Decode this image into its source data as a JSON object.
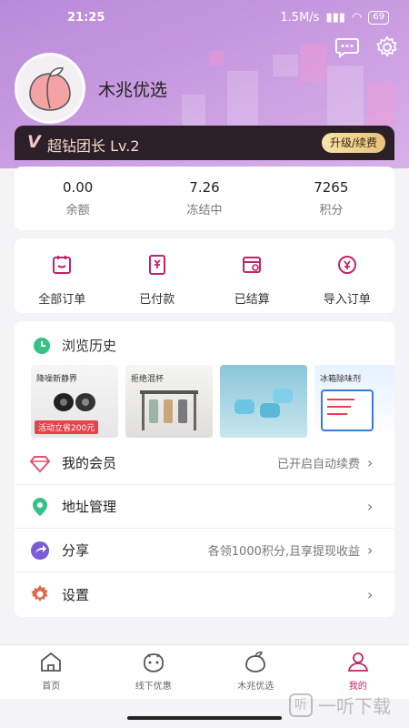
{
  "status_bar": {
    "time": "21:25",
    "network_speed": "1.5M/s",
    "battery": "69"
  },
  "profile": {
    "name": "木兆优选"
  },
  "vip": {
    "mark": "V",
    "title": "超钻团长 Lv.2",
    "upgrade_label": "升级/续费"
  },
  "stats": [
    {
      "value": "0.00",
      "label": "余额"
    },
    {
      "value": "7.26",
      "label": "冻结中"
    },
    {
      "value": "7265",
      "label": "积分"
    }
  ],
  "orders": [
    {
      "label": "全部订单",
      "icon": "calendar-icon"
    },
    {
      "label": "已付款",
      "icon": "paid-receipt-icon"
    },
    {
      "label": "已结算",
      "icon": "settled-box-icon"
    },
    {
      "label": "导入订单",
      "icon": "import-yen-icon"
    }
  ],
  "history": {
    "title": "浏览历史",
    "thumbs": [
      {
        "text": "降噪新静界",
        "tag": "活动立省200元"
      },
      {
        "text": "拒绝混杯",
        "tag": ""
      },
      {
        "text": "",
        "tag": ""
      },
      {
        "text": "冰箱除味剂",
        "tag": ""
      }
    ]
  },
  "menu": [
    {
      "label": "我的会员",
      "value": "已开启自动续费",
      "icon": "diamond-icon",
      "color": "#e05474"
    },
    {
      "label": "地址管理",
      "value": "",
      "icon": "location-pin-icon",
      "color": "#35c287"
    },
    {
      "label": "分享",
      "value": "各领1000积分,且享提现收益",
      "icon": "share-icon",
      "color": "#7b5bd6"
    },
    {
      "label": "设置",
      "value": "",
      "icon": "gear-icon",
      "color": "#e06a4a"
    }
  ],
  "tabs": [
    {
      "label": "首页",
      "icon": "home-icon"
    },
    {
      "label": "线下优惠",
      "icon": "offline-deal-icon"
    },
    {
      "label": "木兆优选",
      "icon": "peach-icon"
    },
    {
      "label": "我的",
      "icon": "user-icon"
    }
  ],
  "watermark": {
    "text": "一听下载",
    "glyph": "听"
  },
  "colors": {
    "accent": "#c0246a",
    "header": "#c89ae0",
    "vip_bar": "#2b1f28",
    "gold": "#e8c27a"
  }
}
